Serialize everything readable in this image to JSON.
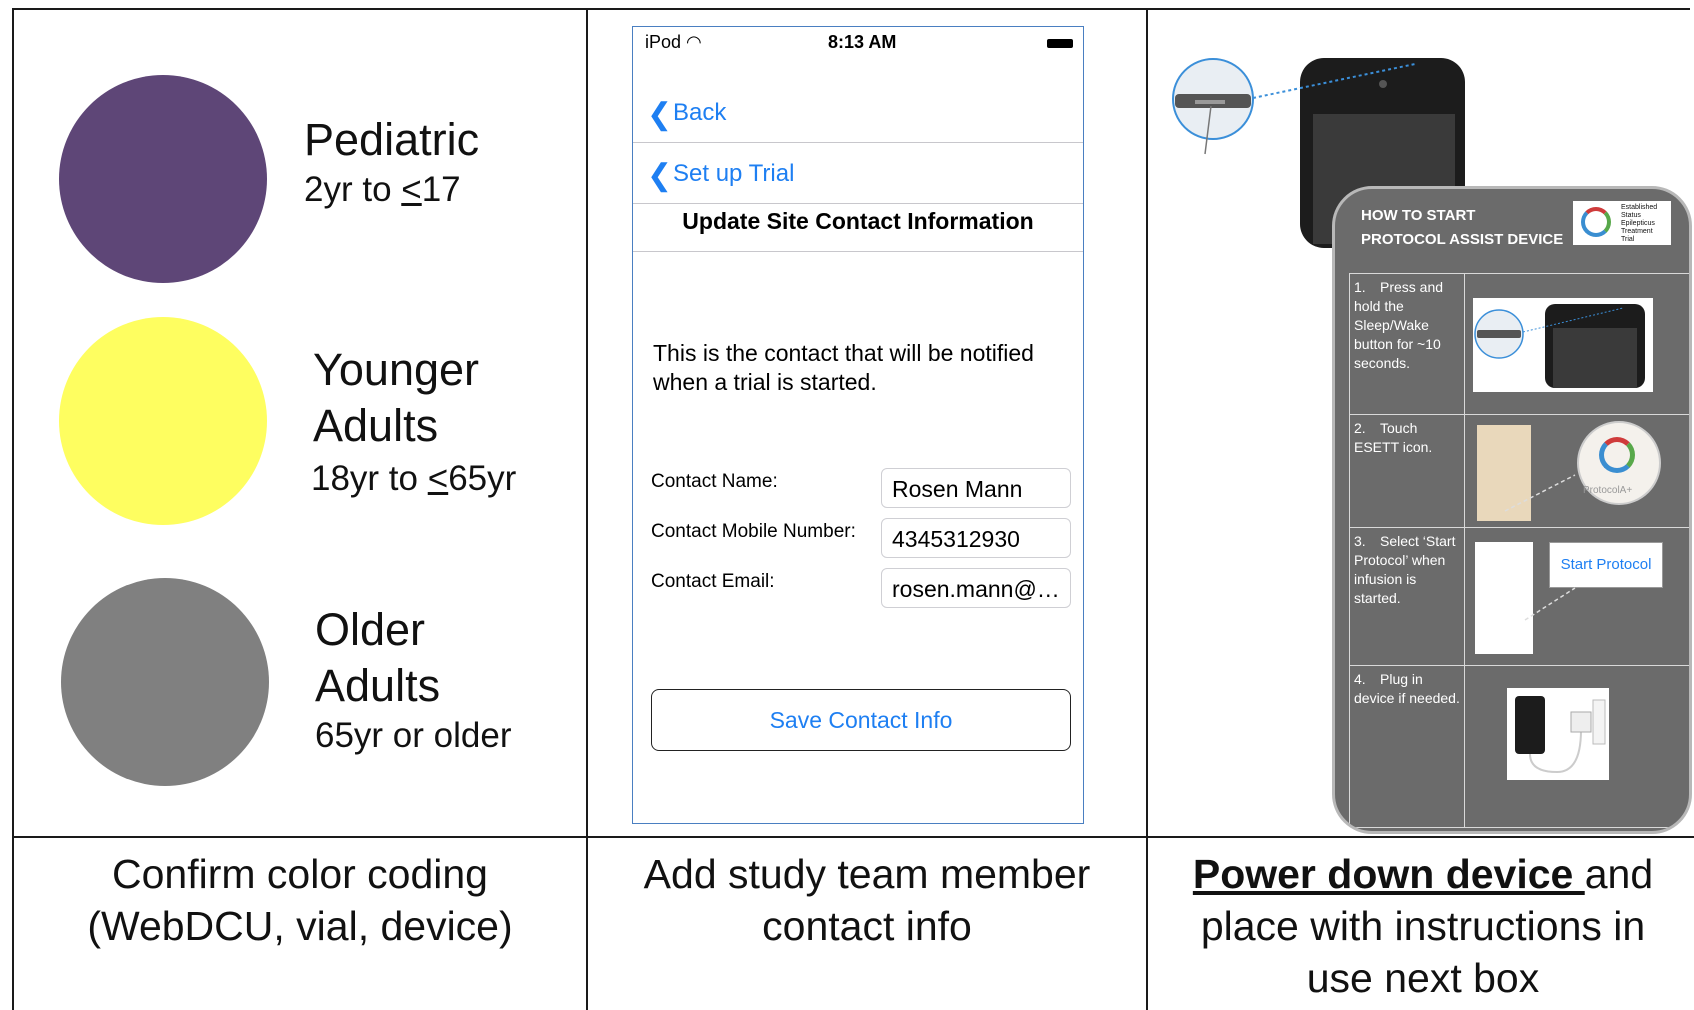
{
  "groups": [
    {
      "name_lines": [
        "Pediatric"
      ],
      "range_prefix": "2yr to ",
      "range_le": "<",
      "range_suffix": "17",
      "color": "#5e4677"
    },
    {
      "name_lines": [
        "Younger",
        "Adults"
      ],
      "range_prefix": "18yr to ",
      "range_le": "<",
      "range_suffix": "65yr",
      "color": "#fefe60"
    },
    {
      "name_lines": [
        "Older",
        "Adults"
      ],
      "range_text": "65yr or older",
      "color": "#808080"
    }
  ],
  "phone": {
    "status": {
      "carrier": "iPod",
      "wifi_icon": "wifi-icon",
      "time": "8:13 AM",
      "battery_icon": "battery-icon"
    },
    "nav_back": "Back",
    "nav_setup": "Set up Trial",
    "title": "Update Site Contact Information",
    "note": "This is the contact that will be notified when a trial is started.",
    "fields": {
      "name_label": "Contact Name:",
      "name_value": "Rosen Mann",
      "mobile_label": "Contact Mobile Number:",
      "mobile_value": "4345312930",
      "email_label": "Contact Email:",
      "email_value": "rosen.mann@…"
    },
    "save_label": "Save Contact Info",
    "accent": "#1e7ff2"
  },
  "card": {
    "title_line1": "HOW TO START",
    "title_line2": "PROTOCOL ASSIST DEVICE",
    "logo_lines": [
      "Established",
      "Status",
      "Epilepticus",
      "Treatment",
      "Trial"
    ],
    "steps": [
      {
        "num": "1.",
        "text": "Press and hold the Sleep/Wake button for ~10 seconds."
      },
      {
        "num": "2.",
        "text": "Touch ESETT icon."
      },
      {
        "num": "3.",
        "text": "Select ‘Start Protocol’ when infusion is started."
      },
      {
        "num": "4.",
        "text": "Plug in device if needed."
      }
    ],
    "start_protocol_label": "Start Protocol",
    "app_icon_label": "ProtocolA+"
  },
  "captions": {
    "col1": "Confirm color coding (WebDCU, vial, device)",
    "col2": "Add study team member contact info",
    "col3_bold": "Power down device ",
    "col3_rest": "and place with instructions in use next box"
  }
}
